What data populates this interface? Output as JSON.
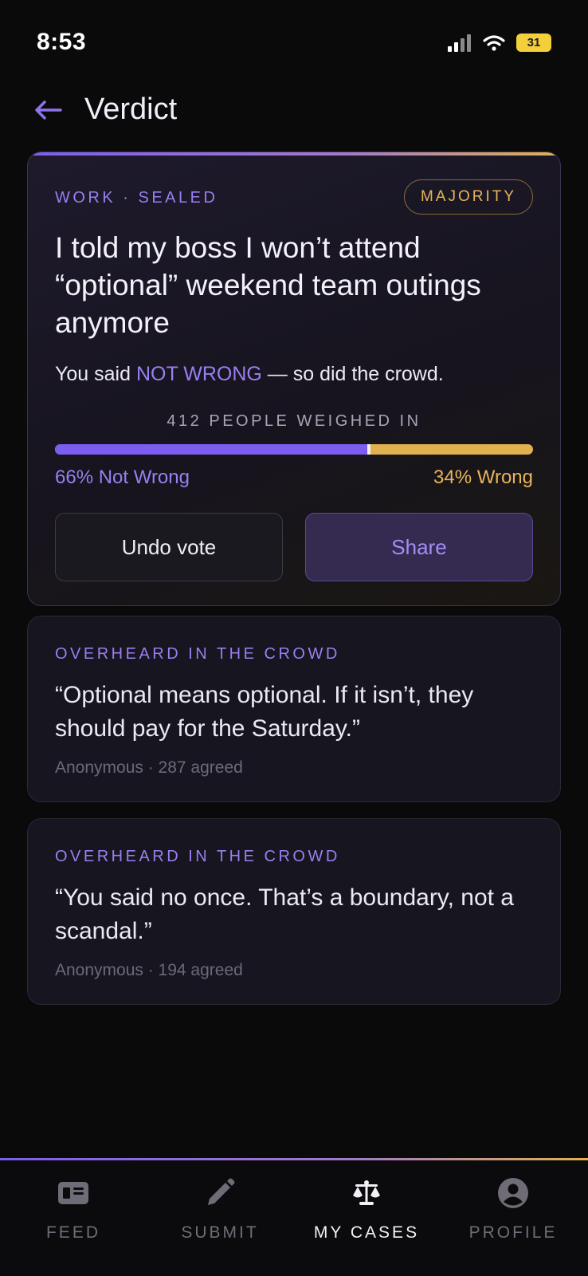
{
  "status_bar": {
    "time": "8:53",
    "battery": "31"
  },
  "header": {
    "title": "Verdict"
  },
  "verdict_card": {
    "category": "WORK · SEALED",
    "badge": "MAJORITY",
    "title": "I told my boss I won’t attend “optional” weekend team outings anymore",
    "verdict_prefix": "You said ",
    "verdict_highlight": "NOT WRONG",
    "verdict_suffix": " — so did the crowd.",
    "participants_label": "412 PEOPLE WEIGHED IN",
    "not_wrong_percent": 66,
    "not_wrong_label": "66% Not Wrong",
    "wrong_label": "34% Wrong",
    "undo_label": "Undo vote",
    "share_label": "Share"
  },
  "quotes": [
    {
      "label": "OVERHEARD IN THE CROWD",
      "text": "“Optional means optional. If it isn’t, they should pay for the Saturday.”",
      "meta": "Anonymous · 287 agreed"
    },
    {
      "label": "OVERHEARD IN THE CROWD",
      "text": "“You said no once. That’s a boundary, not a scandal.”",
      "meta": "Anonymous · 194 agreed"
    }
  ],
  "nav": {
    "items": [
      {
        "label": "FEED",
        "icon": "feed-icon"
      },
      {
        "label": "SUBMIT",
        "icon": "pencil-icon"
      },
      {
        "label": "MY CASES",
        "icon": "scales-icon",
        "active": true
      },
      {
        "label": "PROFILE",
        "icon": "profile-icon"
      }
    ]
  },
  "colors": {
    "accent_purple": "#7b5ef0",
    "accent_gold": "#e2b14f",
    "background": "#0a0a0b"
  }
}
